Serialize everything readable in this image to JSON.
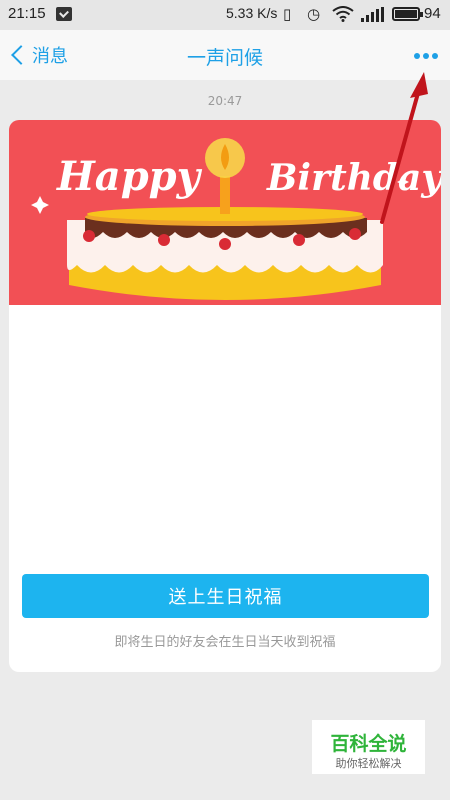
{
  "status_bar": {
    "time": "21:15",
    "net_speed": "5.33 K/s",
    "battery": "94",
    "icons": [
      "message-icon",
      "vibrate-icon",
      "alarm-icon",
      "wifi-icon",
      "signal-icon",
      "battery-icon"
    ]
  },
  "nav": {
    "back_label": "消息",
    "title": "一声问候",
    "more_icon": "more-dots-icon",
    "accent_color": "#1ea0e6"
  },
  "chat": {
    "timestamp": "20:47"
  },
  "card": {
    "banner_text": "Happy Birthday",
    "banner_color": "#f25055",
    "button_label": "送上生日祝福",
    "button_color": "#1db4ef",
    "note": "即将生日的好友会在生日当天收到祝福"
  },
  "watermark": {
    "title": "百科全说",
    "subtitle": "助你轻松解决"
  }
}
